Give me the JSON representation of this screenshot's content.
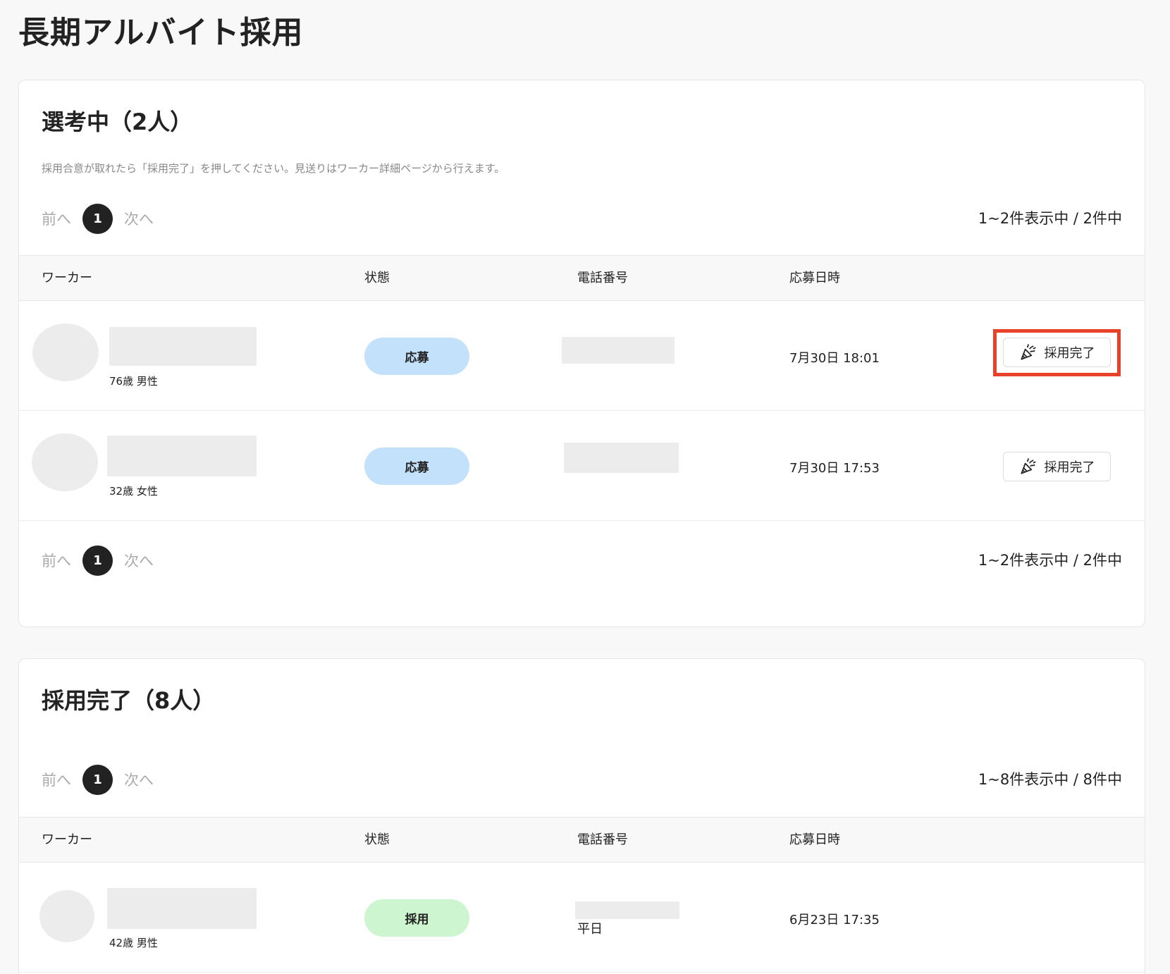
{
  "page": {
    "title": "長期アルバイト採用"
  },
  "selection": {
    "title": "選考中（2人）",
    "note": "採用合意が取れたら「採用完了」を押してください。見送りはワーカー詳細ページから行えます。",
    "pager": {
      "prev": "前へ",
      "current": "1",
      "next": "次へ",
      "count": "1~2件表示中 / 2件中"
    },
    "columns": [
      "ワーカー",
      "状態",
      "電話番号",
      "応募日時"
    ],
    "rows": [
      {
        "meta": "76歳 男性",
        "status": "応募",
        "date": "7月30日 18:01",
        "action": "採用完了"
      },
      {
        "meta": "32歳 女性",
        "status": "応募",
        "date": "7月30日 17:53",
        "action": "採用完了"
      }
    ]
  },
  "hired": {
    "title": "採用完了（8人）",
    "pager": {
      "prev": "前へ",
      "current": "1",
      "next": "次へ",
      "count": "1~8件表示中 / 8件中"
    },
    "columns": [
      "ワーカー",
      "状態",
      "電話番号",
      "応募日時"
    ],
    "rows": [
      {
        "meta": "42歳 男性",
        "status": "採用",
        "phone_note": "平日",
        "date": "6月23日 17:35"
      }
    ]
  },
  "colors": {
    "highlight": "#e8412a",
    "status_apply": "#c3e1fb",
    "status_hired": "#cdf5cf",
    "pager_active": "#222222"
  },
  "icons": {
    "hire_action": "party-popper-icon"
  }
}
